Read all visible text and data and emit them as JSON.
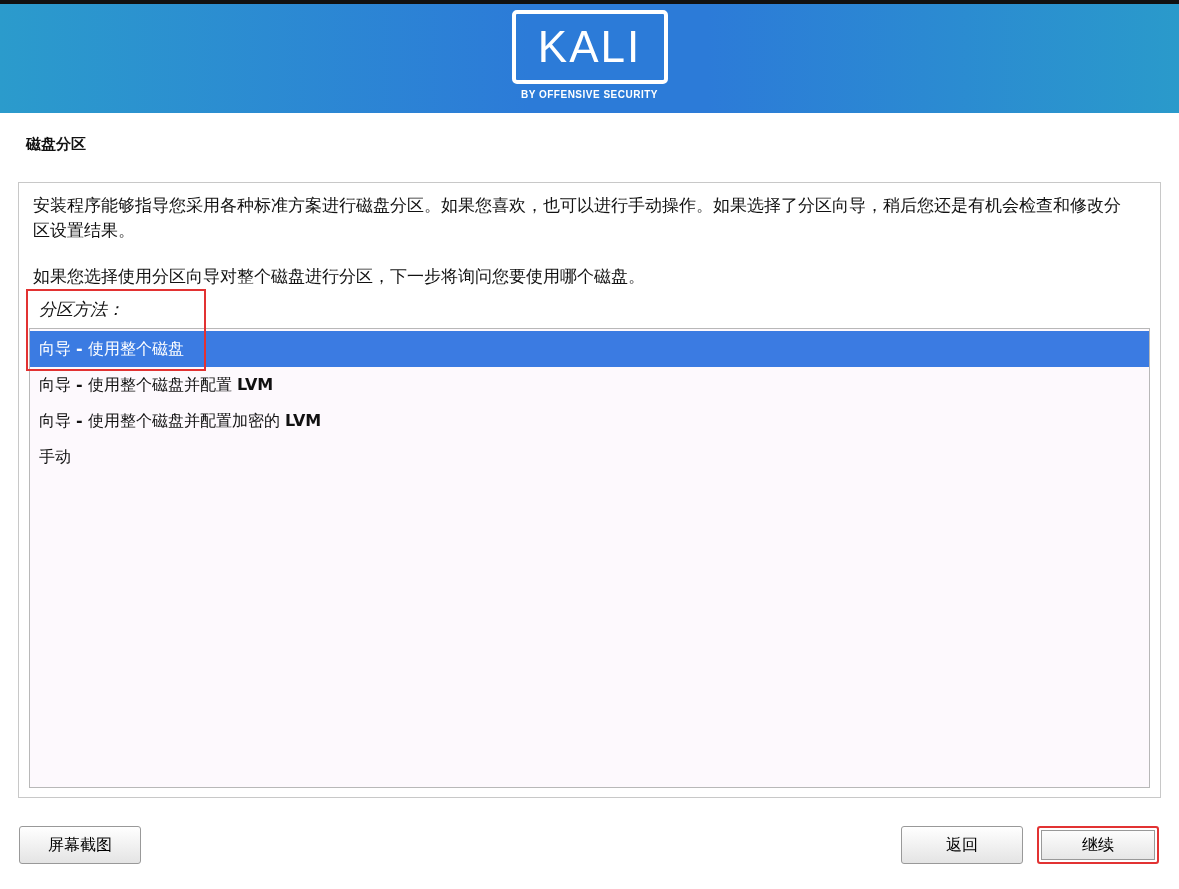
{
  "header": {
    "logo_text": "KALI",
    "logo_tagline": "BY OFFENSIVE SECURITY"
  },
  "title": "磁盘分区",
  "paragraphs": [
    "安装程序能够指导您采用各种标准方案进行磁盘分区。如果您喜欢，也可以进行手动操作。如果选择了分区向导，稍后您还是有机会检查和修改分区设置结果。",
    "如果您选择使用分区向导对整个磁盘进行分区，下一步将询问您要使用哪个磁盘。"
  ],
  "method_label": "分区方法：",
  "method_highlighted": true,
  "options": [
    {
      "label": "向导 **-** 使用整个磁盘",
      "selected": true
    },
    {
      "label": "向导 **-** 使用整个磁盘并配置 **LVM**",
      "selected": false
    },
    {
      "label": "向导 **-** 使用整个磁盘并配置加密的 **LVM**",
      "selected": false
    },
    {
      "label": "手动",
      "selected": false
    }
  ],
  "buttons": [
    {
      "label": "屏幕截图",
      "highlighted": false
    },
    {
      "label": "返回",
      "highlighted": false
    },
    {
      "label": "继续",
      "highlighted": true
    }
  ]
}
